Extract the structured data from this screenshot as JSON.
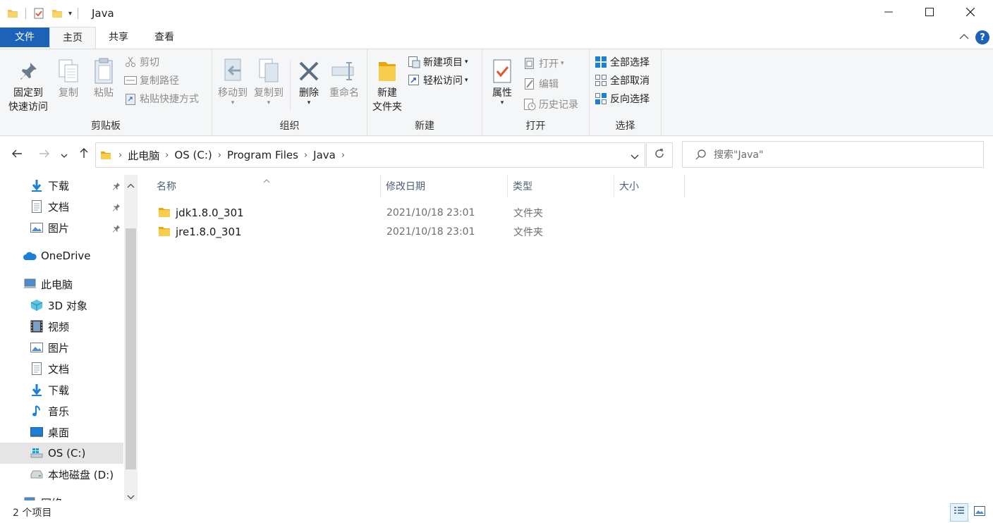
{
  "window": {
    "title": "Java",
    "minimize_icon": "minimize-icon",
    "maximize_icon": "maximize-icon",
    "close_icon": "close-icon"
  },
  "tabs": {
    "file": "文件",
    "home": "主页",
    "share": "共享",
    "view": "查看"
  },
  "ribbon": {
    "clipboard": {
      "label": "剪贴板",
      "pin_line1": "固定到",
      "pin_line2": "快速访问",
      "copy": "复制",
      "paste": "粘贴",
      "cut": "剪切",
      "copy_path": "复制路径",
      "paste_shortcut": "粘贴快捷方式"
    },
    "organize": {
      "label": "组织",
      "move_to": "移动到",
      "copy_to": "复制到",
      "delete": "删除",
      "rename": "重命名"
    },
    "new": {
      "label": "新建",
      "new_folder_line1": "新建",
      "new_folder_line2": "文件夹",
      "new_item": "新建项目",
      "easy_access": "轻松访问"
    },
    "open": {
      "label": "打开",
      "properties": "属性",
      "open": "打开",
      "edit": "编辑",
      "history": "历史记录"
    },
    "select": {
      "label": "选择",
      "select_all": "全部选择",
      "select_none": "全部取消",
      "invert": "反向选择"
    }
  },
  "address": {
    "crumbs": [
      "此电脑",
      "OS (C:)",
      "Program Files",
      "Java"
    ],
    "search_placeholder": "搜索\"Java\""
  },
  "nav": {
    "items": [
      {
        "label": "下载",
        "icon": "download-icon"
      },
      {
        "label": "文档",
        "icon": "document-icon"
      },
      {
        "label": "图片",
        "icon": "picture-icon"
      },
      {
        "label": "OneDrive",
        "icon": "cloud-icon"
      },
      {
        "label": "此电脑",
        "icon": "computer-icon"
      },
      {
        "label": "3D 对象",
        "icon": "cube-icon"
      },
      {
        "label": "视频",
        "icon": "video-icon"
      },
      {
        "label": "图片",
        "icon": "picture-icon"
      },
      {
        "label": "文档",
        "icon": "document-icon"
      },
      {
        "label": "下载",
        "icon": "download-icon"
      },
      {
        "label": "音乐",
        "icon": "music-icon"
      },
      {
        "label": "桌面",
        "icon": "desktop-icon"
      },
      {
        "label": "OS (C:)",
        "icon": "drive-icon"
      },
      {
        "label": "本地磁盘 (D:)",
        "icon": "disk-icon"
      },
      {
        "label": "网络",
        "icon": "network-icon"
      }
    ]
  },
  "columns": {
    "name": "名称",
    "modified": "修改日期",
    "type": "类型",
    "size": "大小"
  },
  "files": [
    {
      "name": "jdk1.8.0_301",
      "modified": "2021/10/18 23:01",
      "type": "文件夹"
    },
    {
      "name": "jre1.8.0_301",
      "modified": "2021/10/18 23:01",
      "type": "文件夹"
    }
  ],
  "status": {
    "count": "2 个项目"
  },
  "colors": {
    "accent": "#1c62b9",
    "folder": "#f4c04d",
    "selected_nav": "#e5e5e5"
  }
}
